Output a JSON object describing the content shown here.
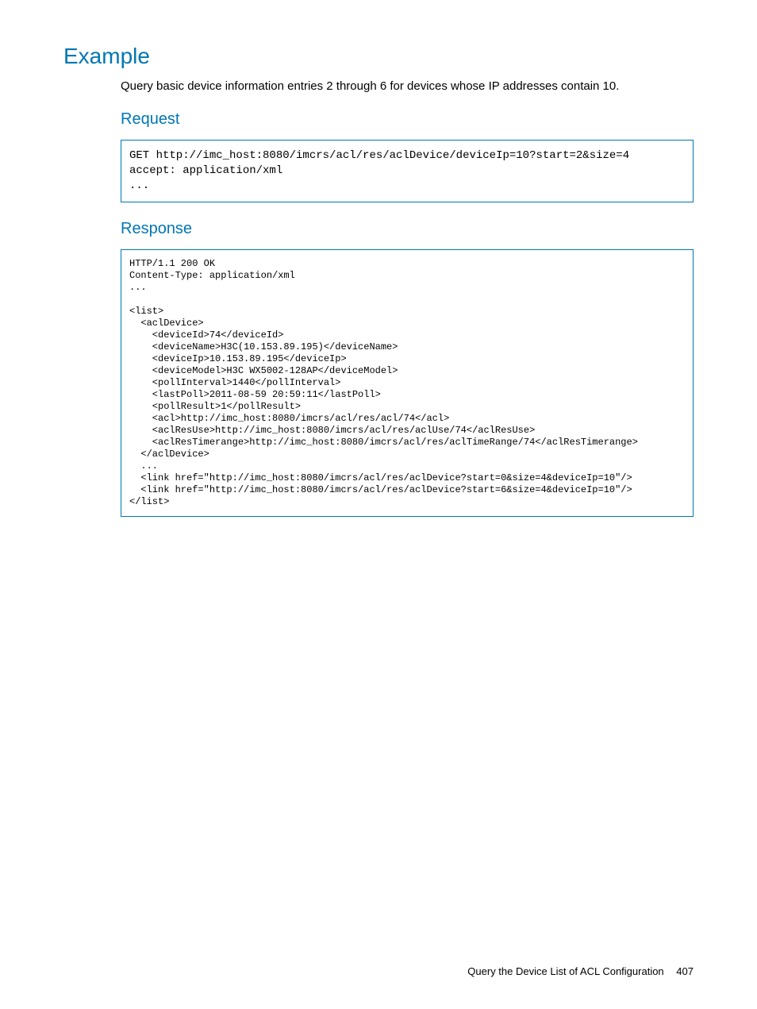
{
  "headings": {
    "example": "Example",
    "request": "Request",
    "response": "Response"
  },
  "intro": "Query basic device information entries 2 through 6 for devices whose IP addresses contain 10.",
  "request_code": "GET http://imc_host:8080/imcrs/acl/res/aclDevice/deviceIp=10?start=2&size=4\naccept: application/xml\n...",
  "response_code": "HTTP/1.1 200 OK\nContent-Type: application/xml\n...\n\n<list>\n  <aclDevice>\n    <deviceId>74</deviceId>\n    <deviceName>H3C(10.153.89.195)</deviceName>\n    <deviceIp>10.153.89.195</deviceIp>\n    <deviceModel>H3C WX5002-128AP</deviceModel>\n    <pollInterval>1440</pollInterval>\n    <lastPoll>2011-08-59 20:59:11</lastPoll>\n    <pollResult>1</pollResult>\n    <acl>http://imc_host:8080/imcrs/acl/res/acl/74</acl>\n    <aclResUse>http://imc_host:8080/imcrs/acl/res/aclUse/74</aclResUse>\n    <aclResTimerange>http://imc_host:8080/imcrs/acl/res/aclTimeRange/74</aclResTimerange>\n  </aclDevice>\n  ...\n  <link href=\"http://imc_host:8080/imcrs/acl/res/aclDevice?start=0&size=4&deviceIp=10\"/>\n  <link href=\"http://imc_host:8080/imcrs/acl/res/aclDevice?start=6&size=4&deviceIp=10\"/>\n</list>",
  "footer": {
    "title": "Query the Device List of ACL Configuration",
    "page": "407"
  }
}
